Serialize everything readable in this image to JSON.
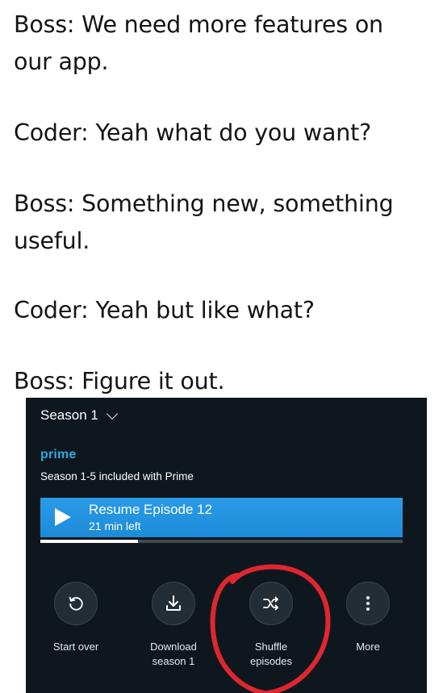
{
  "meme": {
    "line1": "Boss: We need more features on",
    "line1b": "our app.",
    "line2": "Coder: Yeah what do you want?",
    "line3": "Boss: Something new, something",
    "line3b": "useful.",
    "line4": "Coder: Yeah but like what?",
    "line5": "Boss: Figure it out."
  },
  "app": {
    "season_label": "Season 1",
    "season_icon": "chevron-down-icon",
    "prime_logo": "prime",
    "included_text": "Season 1-5 included with Prime",
    "resume": {
      "title": "Resume Episode 12",
      "subtitle": "21 min left",
      "progress": 0.27
    },
    "actions": [
      {
        "label": "Start over",
        "icon": "restart-icon"
      },
      {
        "label": "Download\nseason 1",
        "icon": "download-icon"
      },
      {
        "label": "Shuffle\nepisodes",
        "icon": "shuffle-icon"
      },
      {
        "label": "More",
        "icon": "more-vertical-icon"
      }
    ]
  },
  "colors": {
    "app_background": "#0f171e",
    "accent_blue": "#1d8bd8",
    "prime_blue": "#2aa9e0",
    "annotation_red": "#e0262e"
  }
}
